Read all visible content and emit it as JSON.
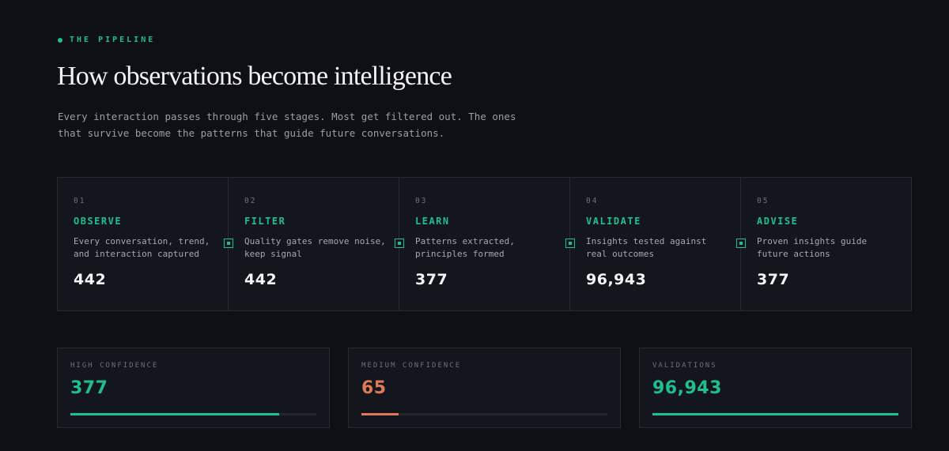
{
  "header": {
    "eyebrow": "THE PIPELINE",
    "title": "How observations become intelligence",
    "subtitle": "Every interaction passes through five stages. Most get filtered out. The ones that survive become the patterns that guide future conversations."
  },
  "stages": [
    {
      "num": "01",
      "name": "OBSERVE",
      "desc": "Every conversation, trend, and interaction captured",
      "value": "442"
    },
    {
      "num": "02",
      "name": "FILTER",
      "desc": "Quality gates remove noise, keep signal",
      "value": "442"
    },
    {
      "num": "03",
      "name": "LEARN",
      "desc": "Patterns extracted, principles formed",
      "value": "377"
    },
    {
      "num": "04",
      "name": "VALIDATE",
      "desc": "Insights tested against real outcomes",
      "value": "96,943"
    },
    {
      "num": "05",
      "name": "ADVISE",
      "desc": "Proven insights guide future actions",
      "value": "377"
    }
  ],
  "metrics": [
    {
      "label": "HIGH CONFIDENCE",
      "value": "377",
      "progress": 0.85,
      "color": "#1fbf8f"
    },
    {
      "label": "MEDIUM CONFIDENCE",
      "value": "65",
      "progress": 0.15,
      "color": "#e07a55"
    },
    {
      "label": "VALIDATIONS",
      "value": "96,943",
      "progress": 1.0,
      "color": "#1fbf8f"
    }
  ],
  "colors": {
    "accent": "#1fbf8f",
    "warning": "#e07a55",
    "background": "#0e1015",
    "panel": "#13161d"
  }
}
